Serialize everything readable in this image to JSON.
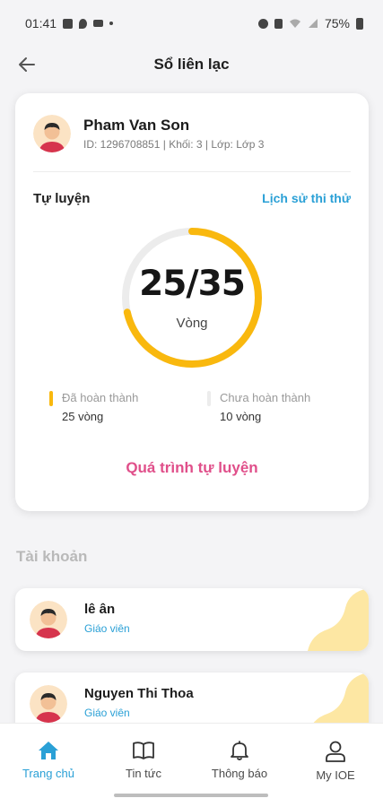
{
  "status_bar": {
    "time": "01:41",
    "battery": "75%"
  },
  "header": {
    "title": "Sổ liên lạc",
    "back_icon": "arrow-left-icon"
  },
  "student": {
    "name": "Pham Van Son",
    "meta": "ID: 1296708851 | Khối: 3 | Lớp: Lớp 3"
  },
  "practice": {
    "label": "Tự luyện",
    "history_link": "Lịch sử thi thử",
    "completed": 25,
    "total": 35,
    "progress_text": "25/35",
    "unit": "Vòng",
    "legend_done_title": "Đã hoàn thành",
    "legend_done_value": "25 vòng",
    "legend_todo_title": "Chưa hoàn thành",
    "legend_todo_value": "10 vòng",
    "process_button": "Quá trình tự luyện"
  },
  "accounts": {
    "section_title": "Tài khoản",
    "items": [
      {
        "name": "lê ân",
        "role": "Giáo viên"
      },
      {
        "name": "Nguyen Thi Thoa",
        "role": "Giáo viên"
      }
    ]
  },
  "nav": {
    "items": [
      {
        "label": "Trang chủ",
        "icon": "home-icon",
        "active": true
      },
      {
        "label": "Tin tức",
        "icon": "book-icon"
      },
      {
        "label": "Thông báo",
        "icon": "bell-icon"
      },
      {
        "label": "My IOE",
        "icon": "user-icon"
      }
    ]
  },
  "colors": {
    "accent": "#2aa0d6",
    "ring_done": "#f9b80e",
    "ring_todo": "#ececec",
    "pink": "#e04f8a",
    "blob": "#fde7a3"
  }
}
